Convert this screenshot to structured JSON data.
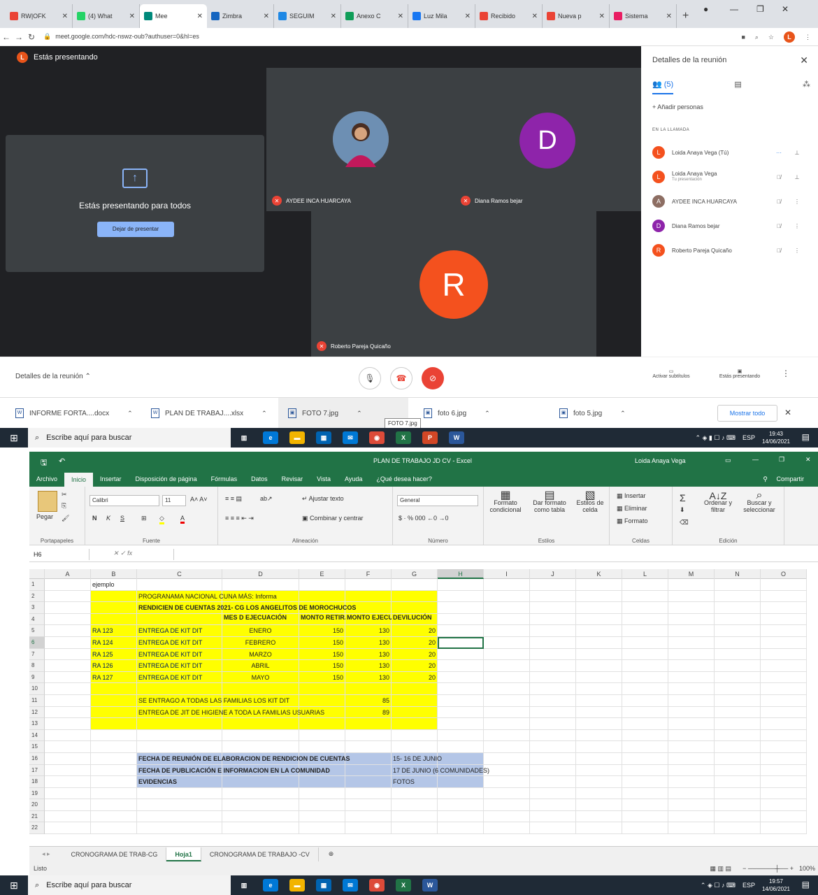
{
  "browser": {
    "tabs": [
      {
        "label": "RW|OFK",
        "color": "#ea4335"
      },
      {
        "label": "(4) What",
        "color": "#25d366"
      },
      {
        "label": "Mee",
        "color": "#00897b"
      },
      {
        "label": "Zimbra",
        "color": "#1565c0"
      },
      {
        "label": "SEGUIM",
        "color": "#1e88e5"
      },
      {
        "label": "Anexo C",
        "color": "#0f9d58"
      },
      {
        "label": "Luz Mila",
        "color": "#1877f2"
      },
      {
        "label": "Recibido",
        "color": "#ea4335"
      },
      {
        "label": "Nueva p",
        "color": "#ea4335"
      },
      {
        "label": "Sistema",
        "color": "#e91e63"
      }
    ],
    "url": "meet.google.com/hdc-nswz-oub?authuser=0&hl=es",
    "avatar_letter": "L"
  },
  "meet": {
    "presenting_status": "Estás presentando",
    "presenting_all": "Estás presentando para todos",
    "stop_button": "Dejar de presentar",
    "participants_tiles": [
      {
        "name": "AYDEE INCA HUARCAYA"
      },
      {
        "name": "Diana Ramos bejar",
        "letter": "D",
        "color": "#8e24aa"
      },
      {
        "name": "Roberto Pareja Quicaño",
        "letter": "R",
        "color": "#f4511e"
      }
    ],
    "panel": {
      "title": "Detalles de la reunión",
      "people_tab": "(5)",
      "add_people": "Añadir personas",
      "section": "EN LA LLAMADA",
      "people": [
        {
          "name": "Loida Anaya Vega (Tú)",
          "letter": "L",
          "color": "#f4511e",
          "sub": ""
        },
        {
          "name": "Loida Anaya Vega",
          "letter": "L",
          "color": "#f4511e",
          "sub": "Tu presentación"
        },
        {
          "name": "AYDEE INCA HUARCAYA",
          "letter": "A",
          "color": "#8d6e63",
          "sub": ""
        },
        {
          "name": "Diana Ramos bejar",
          "letter": "D",
          "color": "#8e24aa",
          "sub": ""
        },
        {
          "name": "Roberto Pareja Quicaño",
          "letter": "R",
          "color": "#f4511e",
          "sub": ""
        }
      ]
    },
    "bottombar": {
      "details": "Detalles de la reunión",
      "subtitles": "Activar subtítulos",
      "presenting": "Estás presentando"
    }
  },
  "downloads": {
    "items": [
      "INFORME FORTA....docx",
      "PLAN DE TRABAJ....xlsx",
      "FOTO 7.jpg",
      "foto 6.jpg",
      "foto 5.jpg"
    ],
    "show_all": "Mostrar todo",
    "tooltip": "FOTO 7.jpg"
  },
  "taskbar1": {
    "search": "Escribe aquí para buscar",
    "lang": "ESP",
    "time": "19:43",
    "date": "14/06/2021"
  },
  "taskbar2": {
    "search": "Escribe aquí para buscar",
    "lang": "ESP",
    "time": "19:57",
    "date": "14/06/2021"
  },
  "excel": {
    "title": "PLAN DE TRABAJO JD CV  -  Excel",
    "user": "Loida Anaya Vega",
    "share": "Compartir",
    "tabs": [
      "Archivo",
      "Inicio",
      "Insertar",
      "Disposición de página",
      "Fórmulas",
      "Datos",
      "Revisar",
      "Vista",
      "Ayuda",
      "¿Qué desea hacer?"
    ],
    "ribbon": {
      "paste": "Pegar",
      "clipboard": "Portapapeles",
      "font_name": "Calibri",
      "font_size": "11",
      "font_group": "Fuente",
      "wrap": "Ajustar texto",
      "merge": "Combinar y centrar",
      "align_group": "Alineación",
      "number_format": "General",
      "number_group": "Número",
      "cond": "Formato condicional",
      "table": "Dar formato como tabla",
      "cellstyles": "Estilos de celda",
      "styles_group": "Estilos",
      "insert": "Insertar",
      "delete": "Eliminar",
      "format": "Formato",
      "cells_group": "Celdas",
      "sort": "Ordenar y filtrar",
      "find": "Buscar y seleccionar",
      "edit_group": "Edición"
    },
    "namebox": "H6",
    "columns": [
      "A",
      "B",
      "C",
      "D",
      "E",
      "F",
      "G",
      "H",
      "I",
      "J",
      "K",
      "L",
      "M",
      "N",
      "O"
    ],
    "rows": [
      {
        "n": "1",
        "B": "ejemplo"
      },
      {
        "n": "2",
        "C": "PROGRANAMA NACIONAL CUNA MÁS: Informa"
      },
      {
        "n": "3",
        "C": "RENDICIEN DE CUENTAS 2021- CG LOS ANGELITOS DE MOROCHUCOS"
      },
      {
        "n": "4",
        "D": "MES D EJECUACIÓN",
        "E": "MONTO RETIRADO",
        "F": "MONTO EJECUTADO",
        "G": "DEVILUCIÓN"
      },
      {
        "n": "5",
        "B": "RA 123",
        "C": "ENTREGA DE KIT DIT",
        "D": "ENERO",
        "E": "150",
        "F": "130",
        "G": "20"
      },
      {
        "n": "6",
        "B": "RA 124",
        "C": "ENTREGA DE KIT DIT",
        "D": "FEBRERO",
        "E": "150",
        "F": "130",
        "G": "20"
      },
      {
        "n": "7",
        "B": "RA 125",
        "C": "ENTREGA DE KIT DIT",
        "D": "MARZO",
        "E": "150",
        "F": "130",
        "G": "20"
      },
      {
        "n": "8",
        "B": "RA 126",
        "C": "ENTREGA DE KIT DIT",
        "D": "ABRIL",
        "E": "150",
        "F": "130",
        "G": "20"
      },
      {
        "n": "9",
        "B": "RA 127",
        "C": "ENTREGA DE KIT DIT",
        "D": "MAYO",
        "E": "150",
        "F": "130",
        "G": "20"
      },
      {
        "n": "10"
      },
      {
        "n": "11",
        "C": "SE ENTRAGO A TODAS LAS FAMILIAS LOS KIT DIT",
        "F": "85"
      },
      {
        "n": "12",
        "C": "ENTREGA DE JIT DE HIGIENE A TODA LA FAMILIAS USUARIAS",
        "F": "89"
      },
      {
        "n": "13"
      },
      {
        "n": "14"
      },
      {
        "n": "15"
      },
      {
        "n": "16",
        "C": "FECHA DE REUNIÓN DE ELABORACION DE RENDICION DE CUENTAS",
        "G": "15- 16 DE JUNIO"
      },
      {
        "n": "17",
        "C": "FECHA DE PUBLICACIÓN E INFORMACION  EN LA COMUNIDAD",
        "G": "17 DE JUNIO (6 COMUNIDADES)"
      },
      {
        "n": "18",
        "C": "EVIDENCIAS",
        "G": "FOTOS"
      },
      {
        "n": "19"
      },
      {
        "n": "20"
      },
      {
        "n": "21"
      },
      {
        "n": "22"
      }
    ],
    "sheets": [
      "CRONOGRAMA DE TRAB-CG",
      "Hoja1",
      "CRONOGRAMA DE TRABAJO -CV"
    ],
    "status": "Listo",
    "zoom": "100%"
  }
}
